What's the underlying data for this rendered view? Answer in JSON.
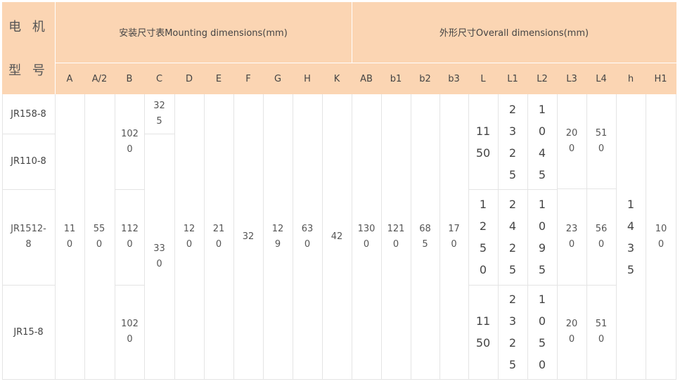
{
  "header": {
    "model_line1": "电 机",
    "model_line2": "型 号",
    "mounting": "安装尺寸表Mounting dimensions(mm)",
    "overall": "外形尺寸Overall dimensions(mm)",
    "columns": [
      "A",
      "A/2",
      "B",
      "C",
      "D",
      "E",
      "F",
      "G",
      "H",
      "K",
      "AB",
      "b1",
      "b2",
      "b3",
      "L",
      "L1",
      "L2",
      "L3",
      "L4",
      "h",
      "H1"
    ]
  },
  "models": [
    "JR158-8",
    "JR110-8",
    "JR1512-8",
    "JR15-8"
  ],
  "values": {
    "A": "110",
    "A2": "550",
    "B": [
      "1020",
      "1120",
      "1020"
    ],
    "C": [
      "325",
      "330"
    ],
    "D": "120",
    "E": "210",
    "F": "32",
    "G": "129",
    "H": "630",
    "K": "42",
    "AB": "1300",
    "b1": "1210",
    "b2": "685",
    "b3": "170",
    "L": [
      "1150",
      "1250",
      "1150"
    ],
    "L1": [
      "2325",
      "2425",
      "2325"
    ],
    "L2": [
      "1045",
      "1095",
      "1050"
    ],
    "L3": [
      "200",
      "230",
      "200"
    ],
    "L4": [
      "510",
      "560",
      "510"
    ],
    "h": "1435",
    "H1": "100"
  }
}
